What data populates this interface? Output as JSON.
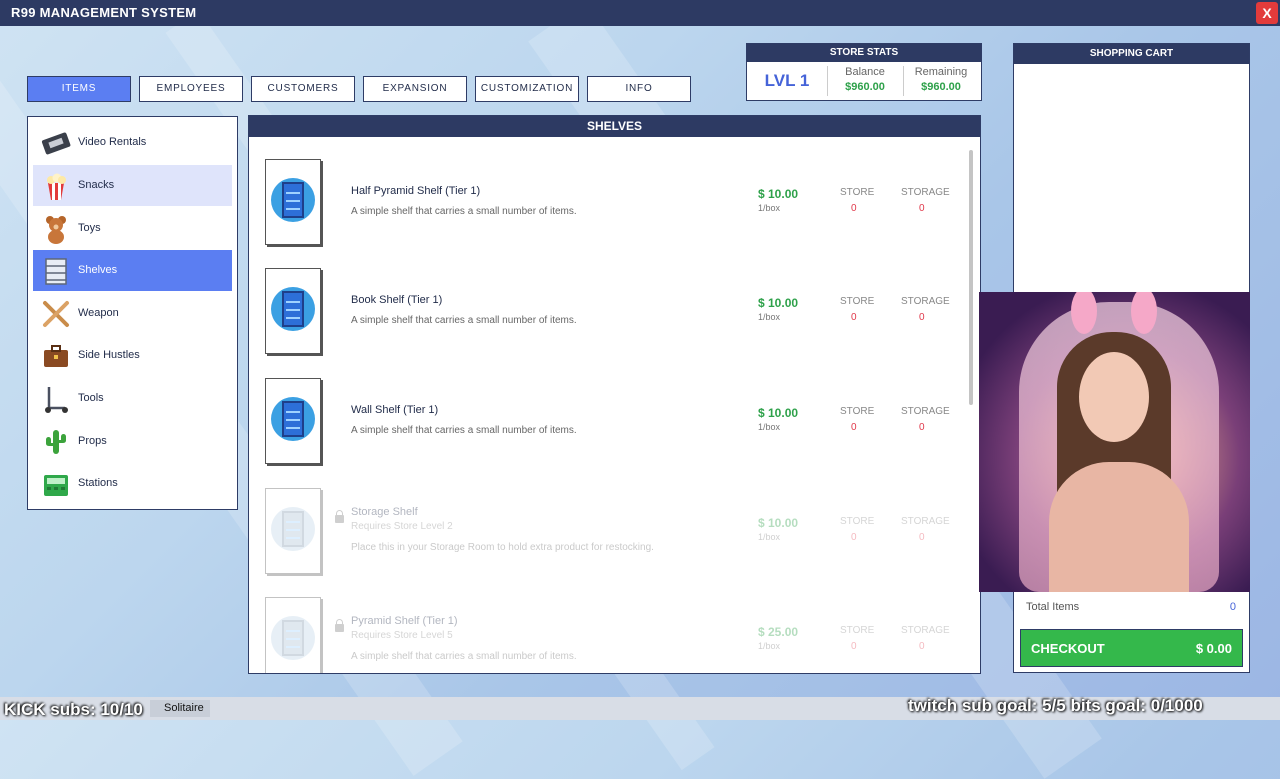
{
  "window": {
    "title": "R99 MANAGEMENT SYSTEM",
    "close_label": "X"
  },
  "tabs": [
    {
      "label": "ITEMS",
      "active": true
    },
    {
      "label": "EMPLOYEES"
    },
    {
      "label": "CUSTOMERS"
    },
    {
      "label": "EXPANSION"
    },
    {
      "label": "CUSTOMIZATION"
    },
    {
      "label": "INFO"
    }
  ],
  "store_stats": {
    "header": "STORE STATS",
    "level": "LVL 1",
    "balance_label": "Balance",
    "balance_value": "$960.00",
    "remaining_label": "Remaining",
    "remaining_value": "$960.00"
  },
  "sidebar": {
    "items": [
      {
        "label": "Video Rentals",
        "icon": "vhs-tape-icon"
      },
      {
        "label": "Snacks",
        "icon": "popcorn-icon",
        "hovered": true
      },
      {
        "label": "Toys",
        "icon": "teddy-bear-icon"
      },
      {
        "label": "Shelves",
        "icon": "shelf-icon",
        "selected": true
      },
      {
        "label": "Weapon",
        "icon": "crossed-bats-icon"
      },
      {
        "label": "Side Hustles",
        "icon": "briefcase-icon"
      },
      {
        "label": "Tools",
        "icon": "scooter-icon"
      },
      {
        "label": "Props",
        "icon": "cactus-icon"
      },
      {
        "label": "Stations",
        "icon": "cash-register-icon"
      }
    ]
  },
  "main": {
    "header": "SHELVES",
    "items": [
      {
        "name": "Half Pyramid Shelf (Tier 1)",
        "desc": "A simple shelf that carries a small number of items.",
        "price": "$ 10.00",
        "unit": "1/box",
        "store_label": "STORE",
        "store_value": "0",
        "storage_label": "STORAGE",
        "storage_value": "0",
        "locked": false
      },
      {
        "name": "Book Shelf (Tier 1)",
        "desc": "A simple shelf that carries a small number of items.",
        "price": "$ 10.00",
        "unit": "1/box",
        "store_label": "STORE",
        "store_value": "0",
        "storage_label": "STORAGE",
        "storage_value": "0",
        "locked": false
      },
      {
        "name": "Wall Shelf (Tier 1)",
        "desc": "A simple shelf that carries a small number of items.",
        "price": "$ 10.00",
        "unit": "1/box",
        "store_label": "STORE",
        "store_value": "0",
        "storage_label": "STORAGE",
        "storage_value": "0",
        "locked": false
      },
      {
        "name": "Storage Shelf",
        "requires": "Requires Store Level 2",
        "desc": "Place this in your Storage Room to hold extra product for restocking.",
        "price": "$ 10.00",
        "unit": "1/box",
        "store_label": "STORE",
        "store_value": "0",
        "storage_label": "STORAGE",
        "storage_value": "0",
        "locked": true
      },
      {
        "name": "Pyramid Shelf (Tier 1)",
        "requires": "Requires Store Level 5",
        "desc": "A simple shelf that carries a small number of items.",
        "price": "$ 25.00",
        "unit": "1/box",
        "store_label": "STORE",
        "store_value": "0",
        "storage_label": "STORAGE",
        "storage_value": "0",
        "locked": true
      }
    ]
  },
  "cart": {
    "header": "SHOPPING CART",
    "total_label": "Total Items",
    "total_value": "0",
    "checkout_label": "CHECKOUT",
    "checkout_amount": "$ 0.00"
  },
  "overlay": {
    "kick_subs": "KICK subs: 10/10",
    "solitaire": "Solitaire",
    "goals": "twitch sub goal: 5/5     bits goal: 0/1000"
  },
  "colors": {
    "accent": "#5b7ef2",
    "header_bg": "#2d3a63",
    "price": "#2ea14a",
    "count": "#e0384a",
    "checkout": "#34b84b"
  }
}
